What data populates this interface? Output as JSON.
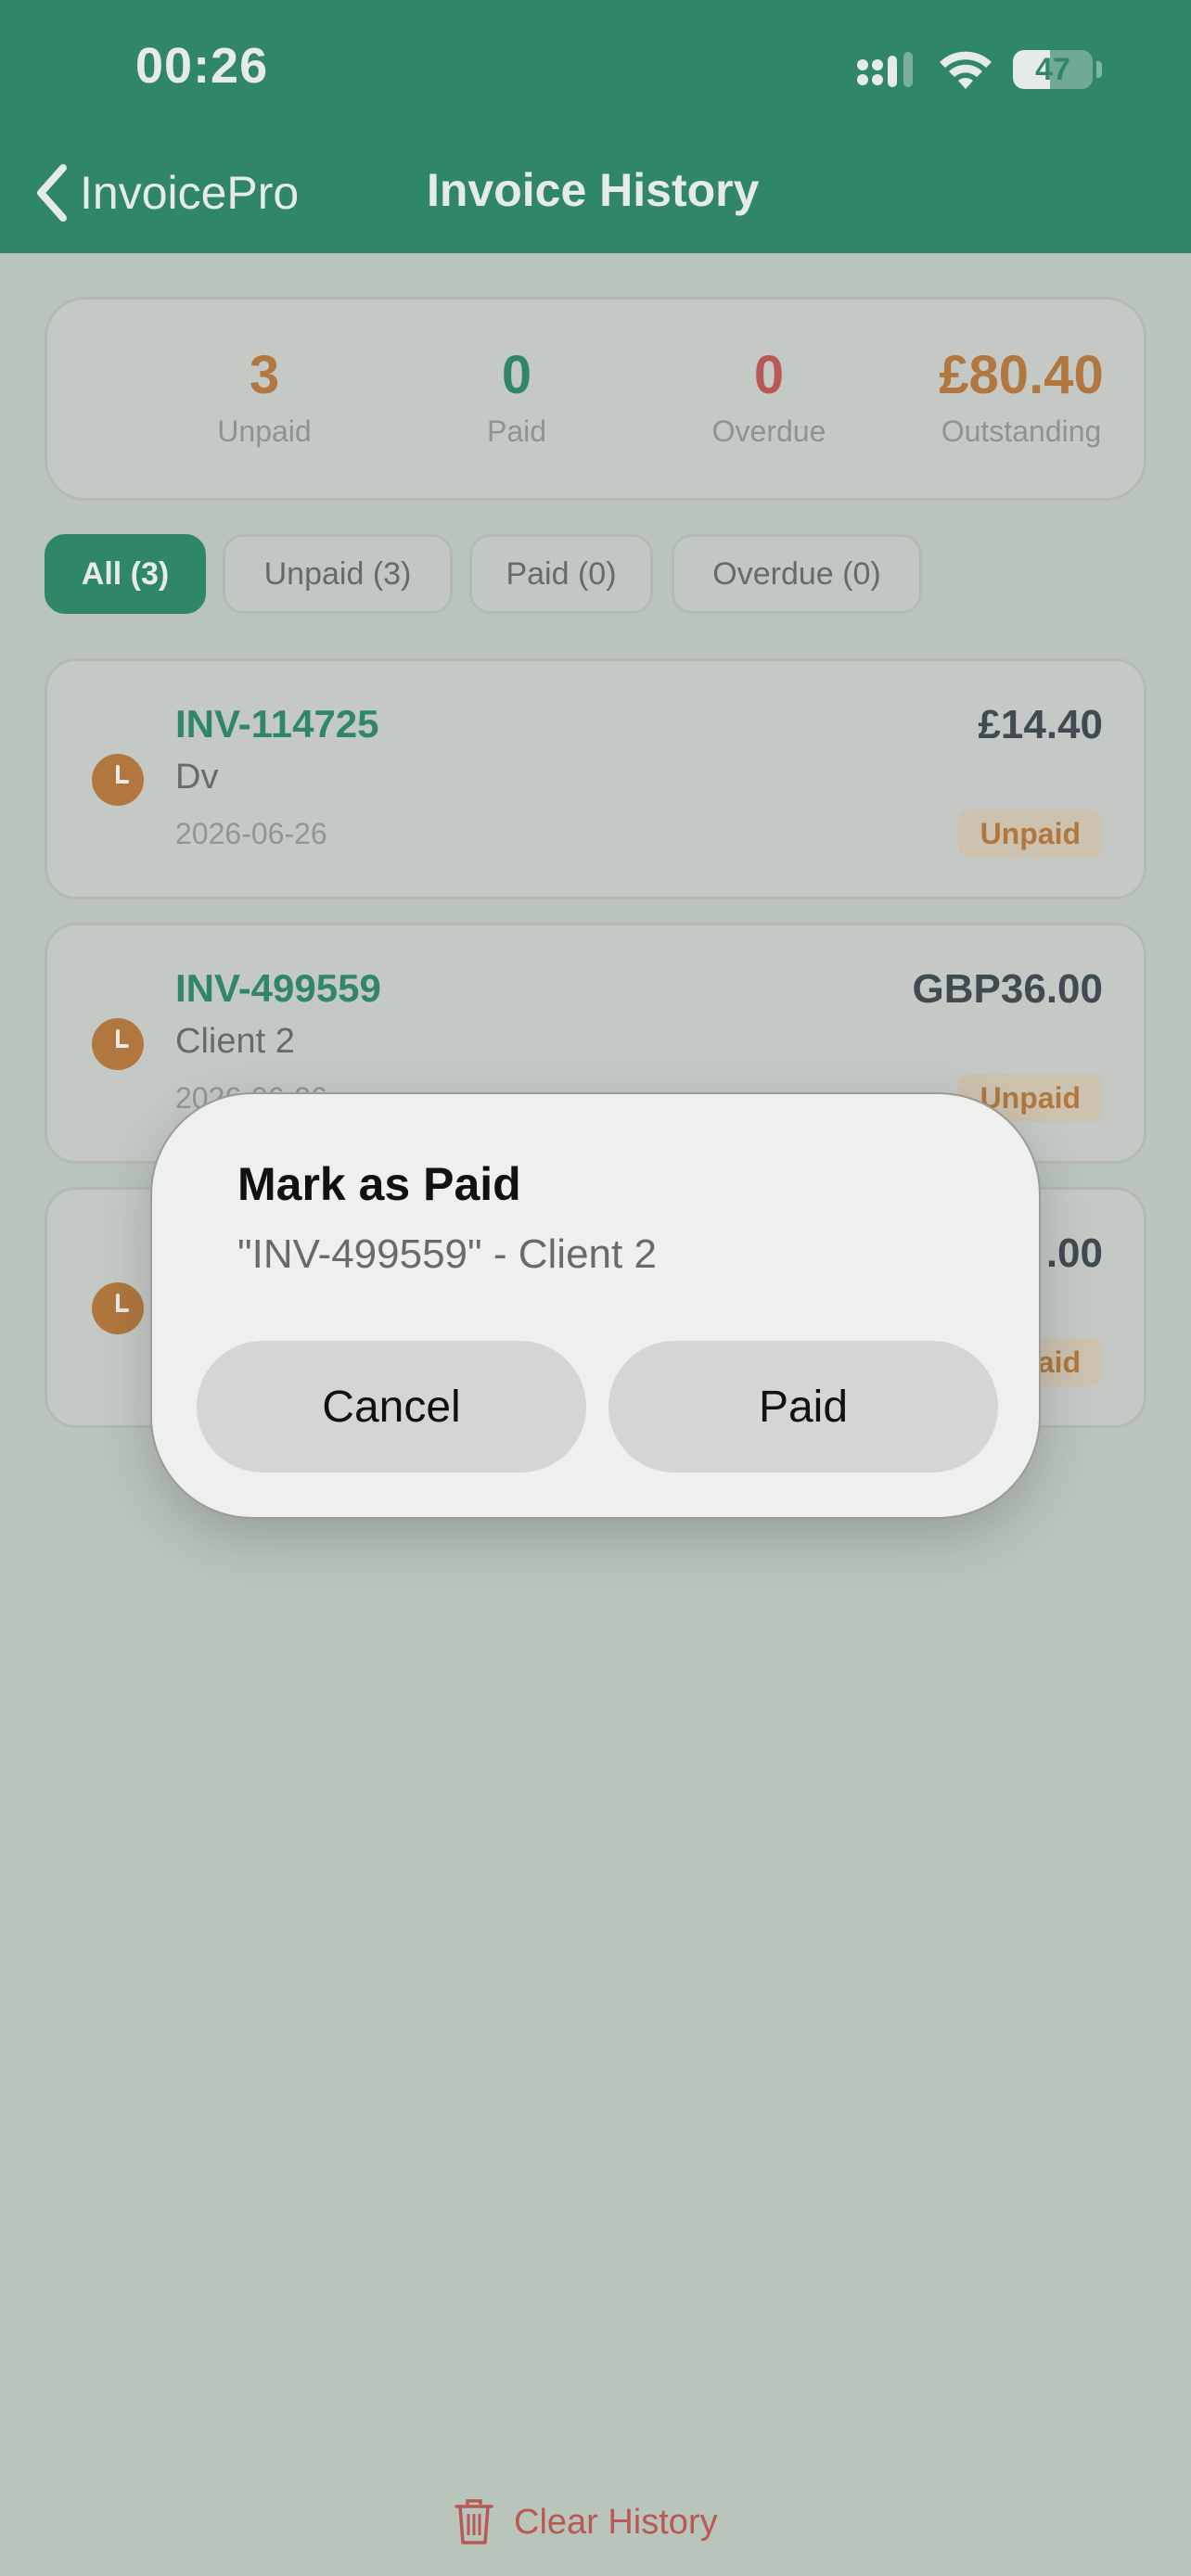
{
  "status_bar": {
    "time": "00:26",
    "battery_percent": 47,
    "battery_label": "47"
  },
  "nav": {
    "back_label": "InvoicePro",
    "title": "Invoice History"
  },
  "summary": {
    "unpaid": {
      "value": "3",
      "label": "Unpaid"
    },
    "paid": {
      "value": "0",
      "label": "Paid"
    },
    "overdue": {
      "value": "0",
      "label": "Overdue"
    },
    "outstanding": {
      "value": "£80.40",
      "label": "Outstanding"
    }
  },
  "filters": [
    "All (3)",
    "Unpaid (3)",
    "Paid (0)",
    "Overdue (0)"
  ],
  "invoices": [
    {
      "number": "INV-114725",
      "client": "Dv",
      "date": "2026-06-26",
      "amount": "£14.40",
      "status": "Unpaid",
      "icon": "clock-icon"
    },
    {
      "number": "INV-499559",
      "client": "Client 2",
      "date": "2026-06-26",
      "amount": "GBP36.00",
      "status": "Unpaid",
      "icon": "clock-icon"
    },
    {
      "number": "",
      "client": "",
      "date": "",
      "amount": ".00",
      "status": "aid",
      "icon": "clock-icon"
    }
  ],
  "clear_history": {
    "label": "Clear History",
    "icon": "trash-icon"
  },
  "dialog": {
    "title": "Mark as Paid",
    "message": "\"INV-499559\" - Client 2",
    "cancel_label": "Cancel",
    "confirm_label": "Paid"
  },
  "colors": {
    "brand_green": "#0b7a54",
    "unpaid_orange": "#b7651d",
    "overdue_red": "#c03d3d",
    "danger_red": "#c03d3d"
  }
}
